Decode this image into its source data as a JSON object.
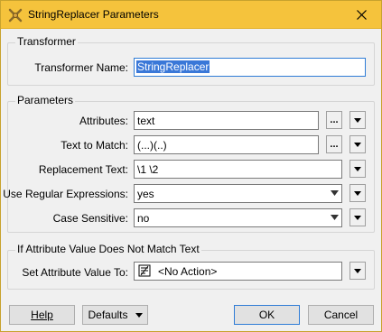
{
  "window": {
    "title": "StringReplacer Parameters"
  },
  "transformer_group": {
    "title": "Transformer",
    "name_label": "Transformer Name:",
    "name_value": "StringReplacer"
  },
  "parameters_group": {
    "title": "Parameters",
    "attributes_label": "Attributes:",
    "attributes_value": "text",
    "text_to_match_label": "Text to Match:",
    "text_to_match_value": "(...)(..)",
    "replacement_text_label": "Replacement Text:",
    "replacement_text_value": "\\1 \\2",
    "use_regex_label": "Use Regular Expressions:",
    "use_regex_value": "yes",
    "case_sensitive_label": "Case Sensitive:",
    "case_sensitive_value": "no",
    "ellipsis_label": "..."
  },
  "mismatch_group": {
    "title": "If Attribute Value Does Not Match Text",
    "set_value_label": "Set Attribute Value To:",
    "set_value_value": "<No Action>"
  },
  "footer": {
    "help_label": "Help",
    "defaults_label": "Defaults",
    "ok_label": "OK",
    "cancel_label": "Cancel"
  }
}
